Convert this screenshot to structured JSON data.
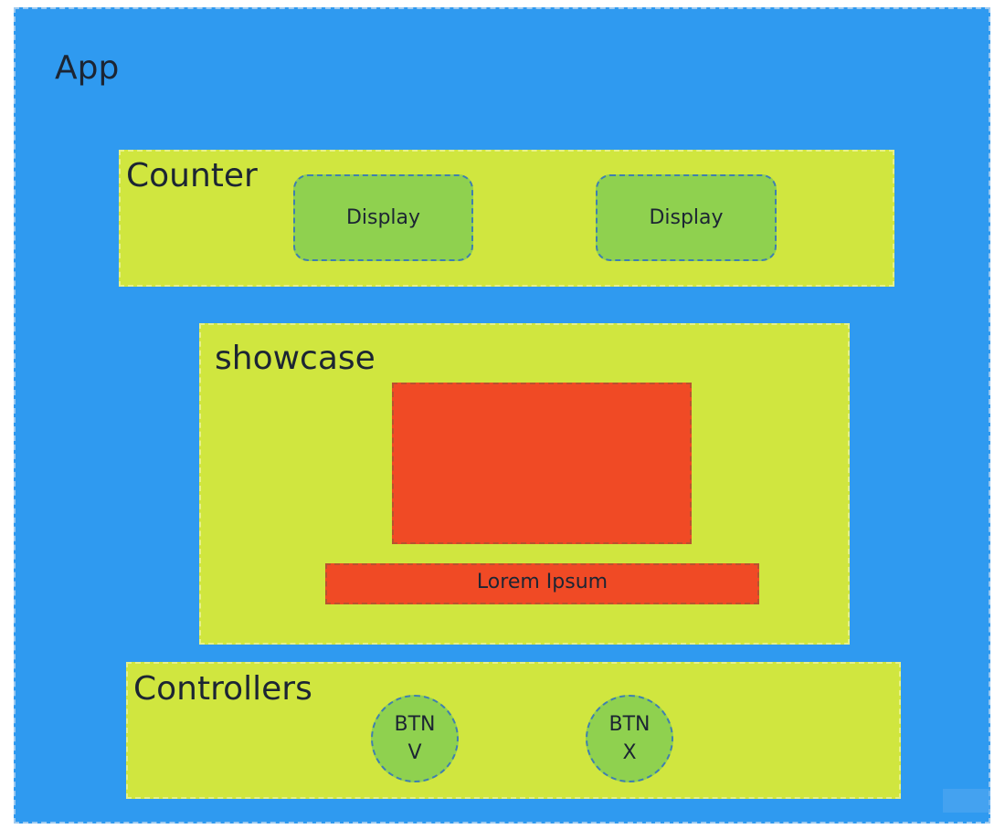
{
  "colors": {
    "app_background": "#2f9af0",
    "zone_background": "#d0e63f",
    "display_background": "#8fd14f",
    "media_background": "#f04a25",
    "text": "#1c2533"
  },
  "app": {
    "label": "App"
  },
  "counter": {
    "label": "Counter",
    "displays": [
      {
        "label": "Display"
      },
      {
        "label": "Display"
      }
    ]
  },
  "showcase": {
    "label": "showcase",
    "caption": "Lorem Ipsum"
  },
  "controllers": {
    "label": "Controllers",
    "buttons": [
      {
        "line1": "BTN",
        "line2": "V"
      },
      {
        "line1": "BTN",
        "line2": "X"
      }
    ]
  }
}
